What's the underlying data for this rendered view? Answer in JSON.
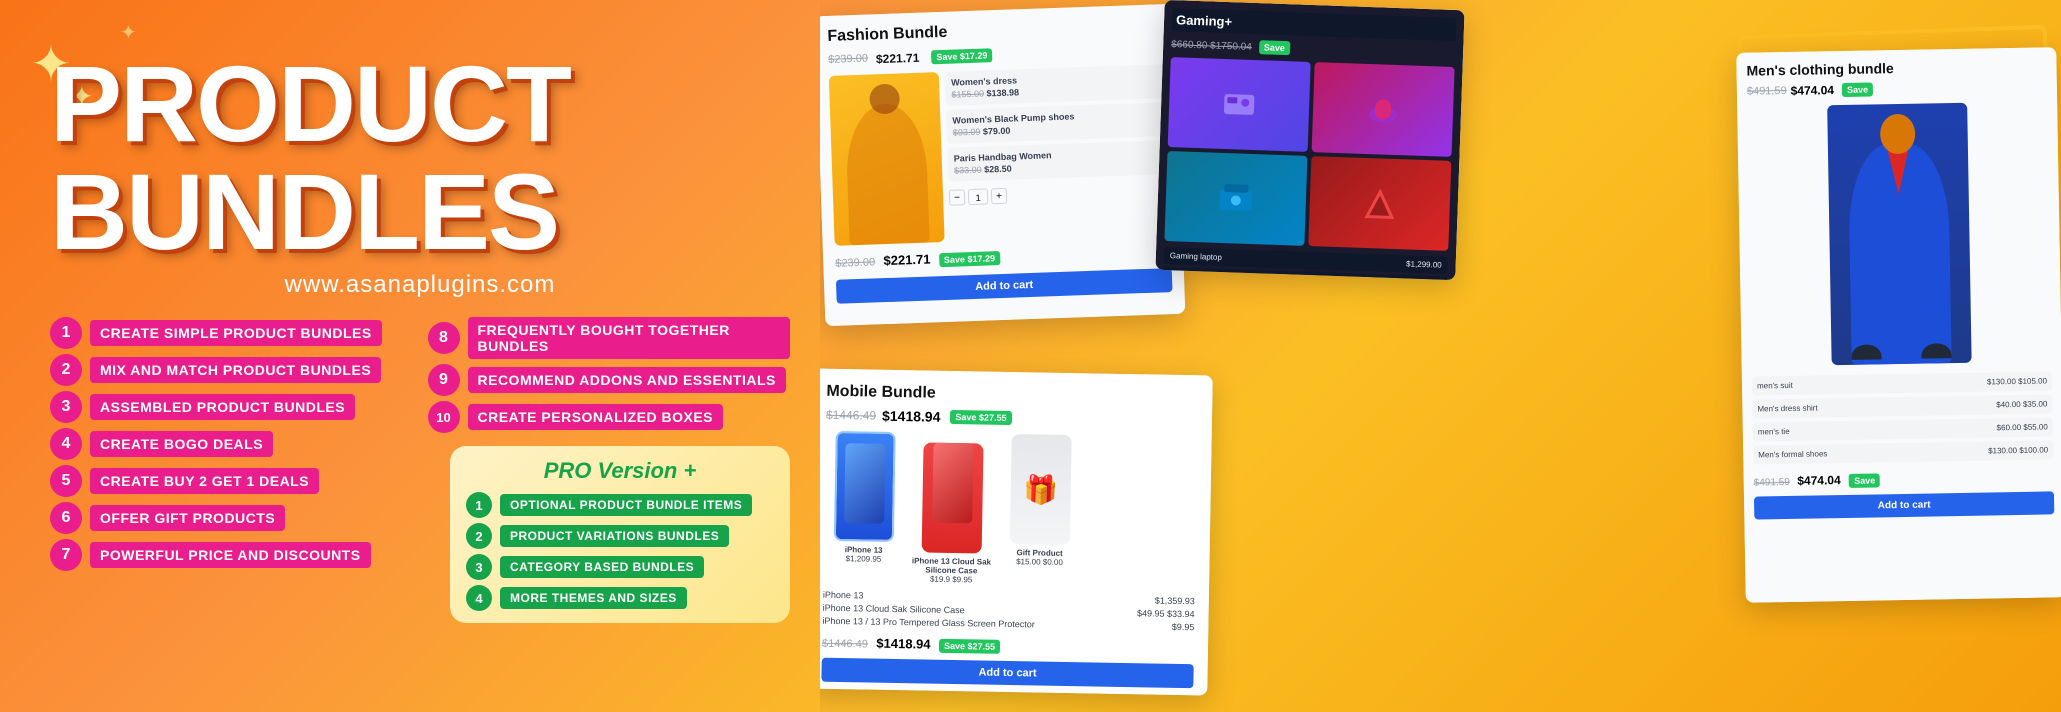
{
  "banner": {
    "title": "PRODUCT BUNDLES",
    "website": "www.asanaplugins.com",
    "accent_color": "#e91e8c",
    "green_color": "#22c55e",
    "features": [
      {
        "num": "1",
        "text": "CREATE SIMPLE PRODUCT BUNDLES"
      },
      {
        "num": "8",
        "text": "FREQUENTLY BOUGHT TOGETHER BUNDLES"
      },
      {
        "num": "2",
        "text": "MIX AND MATCH PRODUCT BUNDLES"
      },
      {
        "num": "9",
        "text": "RECOMMEND ADDONS AND ESSENTIALS"
      },
      {
        "num": "3",
        "text": "ASSEMBLED PRODUCT BUNDLES"
      },
      {
        "num": "10",
        "text": "CREATE PERSONALIZED BOXES"
      },
      {
        "num": "4",
        "text": "CREATE BOGO DEALS"
      },
      {
        "num": "5",
        "text": "CREATE BUY 2 GET 1 DEALS"
      },
      {
        "num": "6",
        "text": "OFFER GIFT PRODUCTS"
      },
      {
        "num": "7",
        "text": "POWERFUL PRICE AND DISCOUNTS"
      }
    ],
    "pro_title": "PRO Version +",
    "pro_items": [
      {
        "num": "1",
        "text": "OPTIONAL PRODUCT BUNDLE ITEMS"
      },
      {
        "num": "2",
        "text": "PRODUCT VARIATIONS BUNDLES"
      },
      {
        "num": "3",
        "text": "CATEGORY BASED BUNDLES"
      },
      {
        "num": "4",
        "text": "MORE THEMES AND SIZES"
      }
    ],
    "cards": {
      "fashion": {
        "title": "Fashion Bundle",
        "price_old": "$239.00",
        "price_new": "$221.71",
        "badge": "Save $17.29"
      },
      "mobile": {
        "title": "Mobile Bundle",
        "price_old": "$1446.49",
        "price_new": "$1418.94",
        "badge": "Save $27.55"
      },
      "mens": {
        "title": "Men's clothing bundle",
        "price_old": "$491.59",
        "price_new": "$474.04",
        "badge": "Save"
      }
    }
  }
}
